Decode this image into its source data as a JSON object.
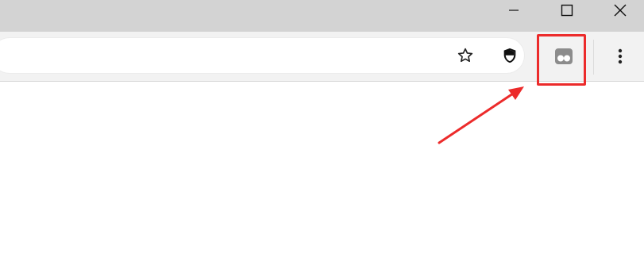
{
  "window_controls": {
    "minimize_icon": "minimize-icon",
    "maximize_icon": "maximize-icon",
    "close_icon": "close-icon"
  },
  "omnibox": {
    "bookmark_icon": "star-outline-icon",
    "security_icon": "shield-icon"
  },
  "toolbar": {
    "extension_icon": "extension-puzzle-face-icon",
    "menu_icon": "vertical-dots-icon"
  },
  "annotation": {
    "highlight_color": "#ec2b2b",
    "arrow_color": "#ec2b2b"
  },
  "colors": {
    "titlebar": "#d3d3d3",
    "toolbar": "#f2f2f2",
    "content": "#ffffff"
  }
}
